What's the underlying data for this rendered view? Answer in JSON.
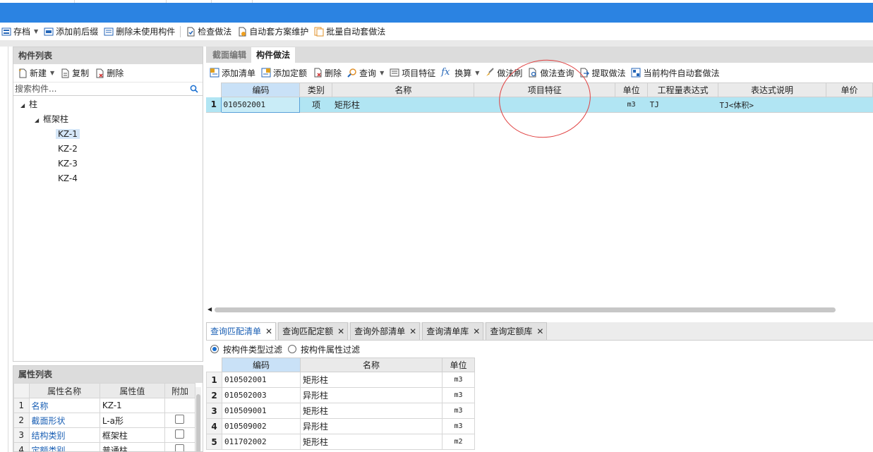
{
  "toolbar": {
    "items": [
      "存档",
      "添加前后缀",
      "删除未使用构件",
      "检查做法",
      "自动套方案维护",
      "批量自动套做法"
    ]
  },
  "component_list": {
    "title": "构件列表",
    "tools": [
      "新建",
      "复制",
      "删除"
    ],
    "search_placeholder": "搜索构件...",
    "tree": {
      "root": "柱",
      "group": "框架柱",
      "items": [
        "KZ-1",
        "KZ-2",
        "KZ-3",
        "KZ-4"
      ],
      "selected": "KZ-1"
    }
  },
  "property_list": {
    "title": "属性列表",
    "headers": [
      "属性名称",
      "属性值",
      "附加"
    ],
    "rows": [
      {
        "n": "1",
        "name": "名称",
        "value": "KZ-1"
      },
      {
        "n": "2",
        "name": "截面形状",
        "value": "L-a形"
      },
      {
        "n": "3",
        "name": "结构类别",
        "value": "框架柱"
      },
      {
        "n": "4",
        "name": "定额类别",
        "value": "普通柱"
      }
    ]
  },
  "main": {
    "tabs": [
      "截面编辑",
      "构件做法"
    ],
    "active_tab": "构件做法",
    "tools": [
      "添加清单",
      "添加定额",
      "删除",
      "查询",
      "项目特征",
      "换算",
      "做法刷",
      "做法查询",
      "提取做法",
      "当前构件自动套做法"
    ],
    "grid": {
      "headers": [
        "编码",
        "类别",
        "名称",
        "项目特征",
        "单位",
        "工程量表达式",
        "表达式说明",
        "单价"
      ],
      "rows": [
        {
          "n": "1",
          "code": "010502001",
          "type": "项",
          "name": "矩形柱",
          "feature": "",
          "unit": "m3",
          "expr": "TJ",
          "desc": "TJ<体积>",
          "price": ""
        }
      ]
    }
  },
  "bottom": {
    "tabs": [
      "查询匹配清单",
      "查询匹配定额",
      "查询外部清单",
      "查询清单库",
      "查询定额库"
    ],
    "active_tab": "查询匹配清单",
    "filters": [
      "按构件类型过滤",
      "按构件属性过滤"
    ],
    "selected_filter": "按构件类型过滤",
    "headers": [
      "编码",
      "名称",
      "单位"
    ],
    "rows": [
      {
        "n": "1",
        "code": "010502001",
        "name": "矩形柱",
        "unit": "m3"
      },
      {
        "n": "2",
        "code": "010502003",
        "name": "异形柱",
        "unit": "m3"
      },
      {
        "n": "3",
        "code": "010509001",
        "name": "矩形柱",
        "unit": "m3"
      },
      {
        "n": "4",
        "code": "010509002",
        "name": "异形柱",
        "unit": "m3"
      },
      {
        "n": "5",
        "code": "011702002",
        "name": "矩形柱",
        "unit": "m2"
      }
    ]
  },
  "colors": {
    "titlebar": "#2b83e2",
    "row_highlight": "#b1e5f3",
    "annotation_circle": "#e04040"
  }
}
